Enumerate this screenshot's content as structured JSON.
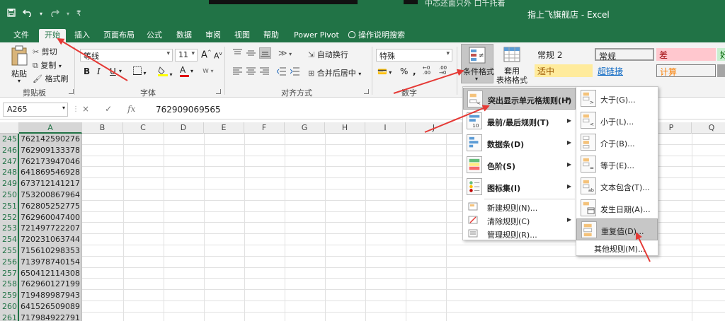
{
  "title_bar": {
    "title": "指上飞旗舰店 - Excel",
    "top_snippet": "中芯还面只外 口千托着",
    "qat": {
      "save_icon": "save-icon",
      "undo_icon": "undo-icon",
      "redo_icon": "redo-icon",
      "customize_icon": "customize-icon"
    }
  },
  "tabs": [
    {
      "label": "文件"
    },
    {
      "label": "开始"
    },
    {
      "label": "插入"
    },
    {
      "label": "页面布局"
    },
    {
      "label": "公式"
    },
    {
      "label": "数据"
    },
    {
      "label": "审阅"
    },
    {
      "label": "视图"
    },
    {
      "label": "帮助"
    },
    {
      "label": "Power Pivot"
    },
    {
      "label": "操作说明搜索"
    }
  ],
  "ribbon": {
    "clipboard": {
      "paste": "粘贴",
      "cut": "剪切",
      "copy": "复制",
      "format_painter": "格式刷",
      "group": "剪贴板"
    },
    "font": {
      "family": "等线",
      "size": "11",
      "group": "字体"
    },
    "alignment": {
      "wrap": "自动换行",
      "merge": "合并后居中",
      "group": "对齐方式"
    },
    "number": {
      "format": "特殊",
      "group": "数字"
    },
    "styles": {
      "conditional": "条件格式",
      "table_format": "套用\n表格格式",
      "cells": [
        {
          "label": "常规 2",
          "bg": "#ffffff",
          "color": "#222222"
        },
        {
          "label": "常规",
          "bg": "#ffffff",
          "color": "#222222"
        },
        {
          "label": "差",
          "bg": "#ffc7ce",
          "color": "#9c0006"
        },
        {
          "label": "好",
          "bg": "#c6efce",
          "color": "#006100"
        },
        {
          "label": "适中",
          "bg": "#ffeb9c",
          "color": "#9c5700"
        },
        {
          "label": "超链接",
          "bg": "#ffffff",
          "color": "#0563c1"
        },
        {
          "label": "计算",
          "bg": "#f2f2f2",
          "color": "#fa7d00"
        }
      ]
    }
  },
  "formula_bar": {
    "name_box": "A265",
    "cancel_icon": "×",
    "enter_icon": "✓",
    "fx_label": "fx",
    "value": "762909069565"
  },
  "grid": {
    "columns": [
      "A",
      "B",
      "C",
      "D",
      "E",
      "F",
      "G",
      "H",
      "I",
      "J",
      "P",
      "Q"
    ],
    "rows": [
      {
        "n": "245",
        "a": "762142590276"
      },
      {
        "n": "246",
        "a": "762909133378"
      },
      {
        "n": "247",
        "a": "762173947046"
      },
      {
        "n": "248",
        "a": "641869546928"
      },
      {
        "n": "249",
        "a": "673712141217"
      },
      {
        "n": "250",
        "a": "753200867964"
      },
      {
        "n": "251",
        "a": "762805252775"
      },
      {
        "n": "252",
        "a": "762960047400"
      },
      {
        "n": "253",
        "a": "721497722207"
      },
      {
        "n": "254",
        "a": "720231063744"
      },
      {
        "n": "255",
        "a": "715610298353"
      },
      {
        "n": "256",
        "a": "713978740154"
      },
      {
        "n": "257",
        "a": "650412114308"
      },
      {
        "n": "258",
        "a": "762960127199"
      },
      {
        "n": "259",
        "a": "719489987943"
      },
      {
        "n": "260",
        "a": "641526509089"
      },
      {
        "n": "261",
        "a": "717984922791"
      }
    ]
  },
  "cond_menu": {
    "items": [
      {
        "label": "突出显示单元格规则(H)"
      },
      {
        "label": "最前/最后规则(T)"
      },
      {
        "label": "数据条(D)"
      },
      {
        "label": "色阶(S)"
      },
      {
        "label": "图标集(I)"
      },
      {
        "label": "新建规则(N)..."
      },
      {
        "label": "清除规则(C)"
      },
      {
        "label": "管理规则(R)..."
      }
    ]
  },
  "highlight_menu": {
    "items": [
      {
        "label": "大于(G)..."
      },
      {
        "label": "小于(L)..."
      },
      {
        "label": "介于(B)..."
      },
      {
        "label": "等于(E)..."
      },
      {
        "label": "文本包含(T)..."
      },
      {
        "label": "发生日期(A)..."
      },
      {
        "label": "重复值(D)..."
      }
    ],
    "footer": "其他规则(M)..."
  },
  "annotation_color": "#e53935"
}
